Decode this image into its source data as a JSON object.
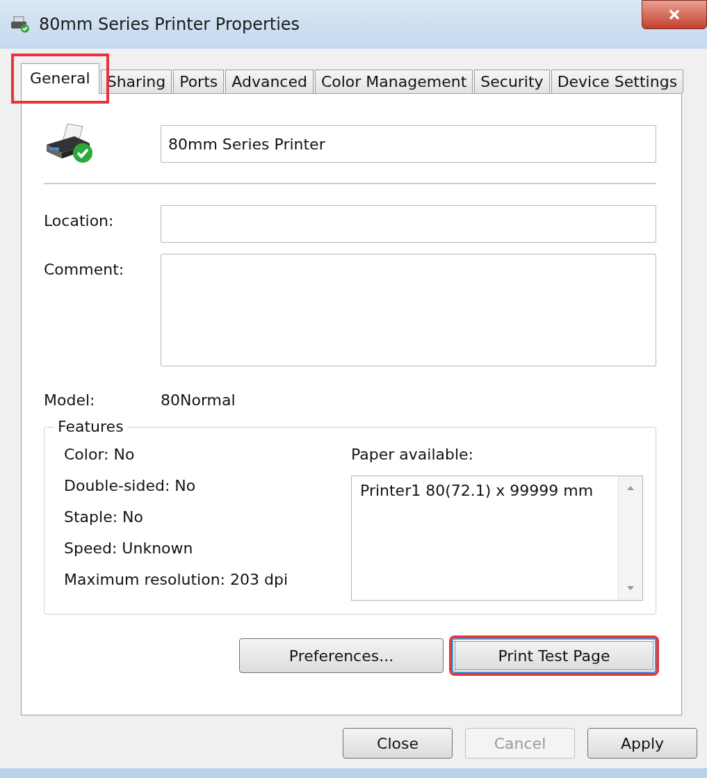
{
  "window": {
    "title": "80mm Series Printer Properties"
  },
  "tabs": [
    {
      "label": "General",
      "selected": true,
      "highlighted": true
    },
    {
      "label": "Sharing",
      "selected": false,
      "highlighted": false
    },
    {
      "label": "Ports",
      "selected": false,
      "highlighted": false
    },
    {
      "label": "Advanced",
      "selected": false,
      "highlighted": false
    },
    {
      "label": "Color Management",
      "selected": false,
      "highlighted": false
    },
    {
      "label": "Security",
      "selected": false,
      "highlighted": false
    },
    {
      "label": "Device Settings",
      "selected": false,
      "highlighted": false
    }
  ],
  "printer_name": {
    "value": "80mm Series Printer"
  },
  "location": {
    "label": "Location:"
  },
  "comment": {
    "label": "Comment:"
  },
  "model": {
    "label": "Model:",
    "value": "80Normal"
  },
  "features": {
    "title": "Features",
    "items": [
      "Color: No",
      "Double-sided: No",
      "Staple: No",
      "Speed: Unknown",
      "Maximum resolution: 203 dpi"
    ],
    "paper_label": "Paper available:",
    "paper": [
      "Printer1 80(72.1) x 99999 mm"
    ]
  },
  "panel_buttons": [
    {
      "label": "Preferences...",
      "focused": false,
      "highlighted": false
    },
    {
      "label": "Print Test Page",
      "focused": true,
      "highlighted": true
    }
  ],
  "buttons": [
    {
      "label": "Close",
      "disabled": false
    },
    {
      "label": "Cancel",
      "disabled": true
    },
    {
      "label": "Apply",
      "disabled": false
    }
  ]
}
